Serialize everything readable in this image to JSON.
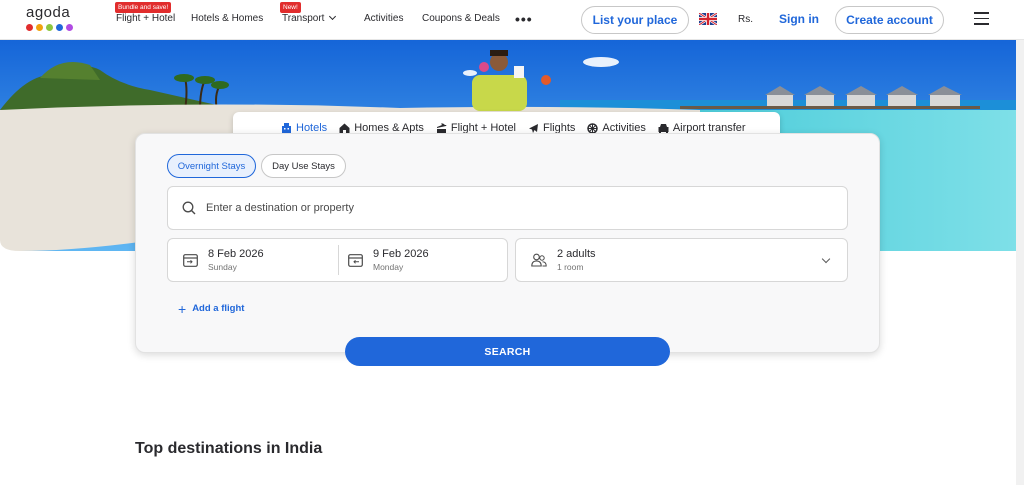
{
  "header": {
    "logo_text": "agoda",
    "logo_dot_colors": [
      "#e12d2d",
      "#f1a20e",
      "#8dc63f",
      "#2067da",
      "#b14ce3"
    ],
    "nav": [
      {
        "label": "Flight + Hotel",
        "badge": "Bundle and save!"
      },
      {
        "label": "Hotels & Homes",
        "badge": ""
      },
      {
        "label": "Transport",
        "badge": "New!"
      },
      {
        "label": "Activities",
        "badge": ""
      },
      {
        "label": "Coupons & Deals",
        "badge": ""
      }
    ],
    "more_label": "•••",
    "list_property_label": "List your place",
    "currency": "Rs.",
    "signin_label": "Sign in",
    "create_account_label": "Create account"
  },
  "product_tabs": [
    {
      "label": "Hotels",
      "icon": "hotel-icon",
      "active": true
    },
    {
      "label": "Homes & Apts",
      "icon": "home-icon",
      "active": false
    },
    {
      "label": "Flight + Hotel",
      "icon": "flight-hotel-icon",
      "active": false
    },
    {
      "label": "Flights",
      "icon": "plane-icon",
      "active": false
    },
    {
      "label": "Activities",
      "icon": "activities-icon",
      "active": false
    },
    {
      "label": "Airport transfer",
      "icon": "car-icon",
      "active": false
    }
  ],
  "search": {
    "stay_types": [
      {
        "label": "Overnight Stays",
        "active": true
      },
      {
        "label": "Day Use Stays",
        "active": false
      }
    ],
    "destination_placeholder": "Enter a destination or property",
    "checkin": {
      "date": "8 Feb 2026",
      "day": "Sunday"
    },
    "checkout": {
      "date": "9 Feb 2026",
      "day": "Monday"
    },
    "occupancy": {
      "guests": "2 adults",
      "rooms": "1 room"
    },
    "add_flight_label": "Add a flight",
    "search_button_label": "SEARCH"
  },
  "section_title": "Top destinations in India",
  "colors": {
    "brand_blue": "#2067da",
    "badge_red": "#e12d2d"
  }
}
